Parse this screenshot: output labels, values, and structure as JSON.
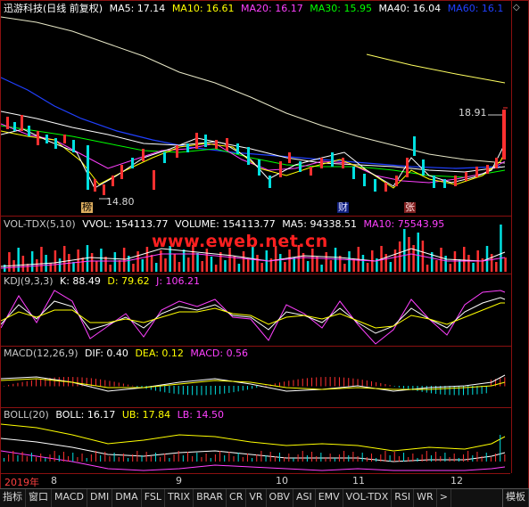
{
  "main": {
    "title": "迅游科技(日线 前复权)",
    "ma": [
      {
        "label": "MA5: 17.14",
        "color": "#ffffff"
      },
      {
        "label": "MA10: 16.61",
        "color": "#ffff00"
      },
      {
        "label": "MA20: 16.17",
        "color": "#ff40ff"
      },
      {
        "label": "MA30: 15.95",
        "color": "#00ff00"
      },
      {
        "label": "MA40: 16.04",
        "color": "#ffffff"
      },
      {
        "label": "MA60: 16.1",
        "color": "#2040ff"
      }
    ],
    "high_label": "18.91",
    "low_label": "14.80",
    "tags": [
      "榜",
      "财",
      "张"
    ]
  },
  "vol": {
    "items": [
      {
        "label": "VOL-TDX(5,10)",
        "color": "#c8c8c8"
      },
      {
        "label": "VVOL: 154113.77",
        "color": "#ffffff"
      },
      {
        "label": "VOLUME: 154113.77",
        "color": "#ffffff"
      },
      {
        "label": "MA5: 94338.51",
        "color": "#ffffff"
      },
      {
        "label": "MA10: 75543.95",
        "color": "#ff40ff"
      }
    ]
  },
  "watermark": "www.eweb.net.cn",
  "kdj": {
    "items": [
      {
        "label": "KDJ(9,3,3)",
        "color": "#c8c8c8"
      },
      {
        "label": "K: 88.49",
        "color": "#ffffff"
      },
      {
        "label": "D: 79.62",
        "color": "#ffff00"
      },
      {
        "label": "J: 106.21",
        "color": "#ff40ff"
      }
    ]
  },
  "macd": {
    "items": [
      {
        "label": "MACD(12,26,9)",
        "color": "#c8c8c8"
      },
      {
        "label": "DIF: 0.40",
        "color": "#ffffff"
      },
      {
        "label": "DEA: 0.12",
        "color": "#ffff00"
      },
      {
        "label": "MACD: 0.56",
        "color": "#ff40ff"
      }
    ]
  },
  "boll": {
    "items": [
      {
        "label": "BOLL(20)",
        "color": "#c8c8c8"
      },
      {
        "label": "BOLL: 16.17",
        "color": "#ffffff"
      },
      {
        "label": "UB: 17.84",
        "color": "#ffff00"
      },
      {
        "label": "LB: 14.50",
        "color": "#ff40ff"
      }
    ]
  },
  "axis": {
    "labels": [
      "2019年",
      "8",
      "9",
      "10",
      "11",
      "12"
    ]
  },
  "tabs": [
    "指标",
    "窗口",
    "MACD",
    "DMI",
    "DMA",
    "FSL",
    "TRIX",
    "BRAR",
    "CR",
    "VR",
    "OBV",
    "ASI",
    "EMV",
    "VOL-TDX",
    "RSI",
    "WR",
    ">",
    "模板"
  ]
}
